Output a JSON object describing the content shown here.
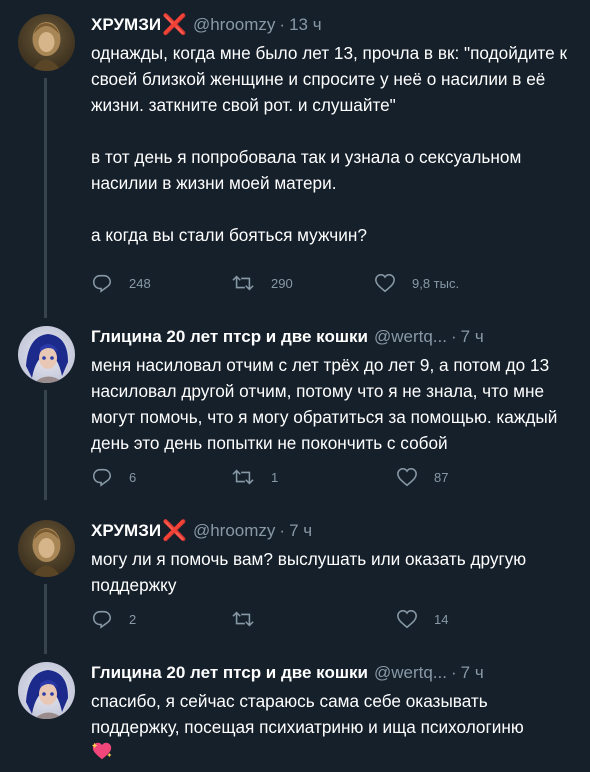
{
  "tweets": [
    {
      "name": "ХРУМЗИ",
      "name_mark": "❌",
      "handle": "@hroomzy",
      "time": "13 ч",
      "paragraphs": [
        "однажды, когда мне было лет 13, прочла в вк: \"подойдите к своей близкой женщине и спросите у неё о насилии в её жизни. заткните свой рот. и слушайте\"",
        "в тот день я попробовала так и узнала о сексуальном насилии в жизни моей матери.",
        "а когда вы стали бояться мужчин?"
      ],
      "replies": "248",
      "retweets": "290",
      "likes": "9,8 тыс."
    },
    {
      "name": "Глицина 20 лет птср и две кошки",
      "handle": "@wertq...",
      "time": "7 ч",
      "paragraphs": [
        "меня насиловал отчим с лет трёх до лет 9, а потом до 13 насиловал другой отчим, потому что я не знала, что мне могут помочь, что я могу обратиться за помощью. каждый день это день попытки не покончить с собой"
      ],
      "replies": "6",
      "retweets": "1",
      "likes": "87"
    },
    {
      "name": "ХРУМЗИ",
      "name_mark": "❌",
      "handle": "@hroomzy",
      "time": "7 ч",
      "paragraphs": [
        "могу ли я помочь вам? выслушать или оказать другую поддержку"
      ],
      "replies": "2",
      "retweets": "",
      "likes": "14"
    },
    {
      "name": "Глицина 20 лет птср и две кошки",
      "handle": "@wertq...",
      "time": "7 ч",
      "paragraphs": [
        "спасибо, я сейчас стараюсь сама себе оказывать поддержку, посещая психиатриню и ища психологиню"
      ],
      "emoji": "sparkling-heart"
    }
  ],
  "colors": {
    "background": "#15202b",
    "secondary_text": "#8899a6",
    "thread_line": "#38444d",
    "name_mark": "#e0253a"
  },
  "icons": [
    "reply-icon",
    "retweet-icon",
    "like-icon",
    "sparkling-heart-emoji"
  ]
}
